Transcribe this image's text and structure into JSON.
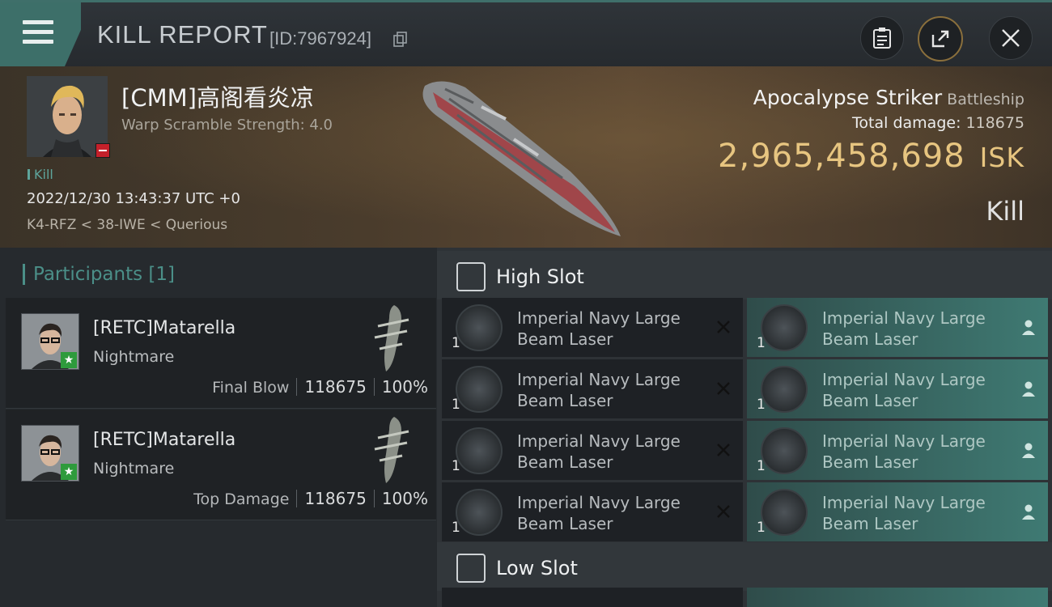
{
  "header": {
    "title": "KILL REPORT",
    "id_label": "[ID:7967924]",
    "icons": [
      "menu-icon",
      "copy-icon",
      "clipboard-icon",
      "share-icon",
      "close-icon"
    ]
  },
  "victim": {
    "name": "[CMM]高阁看炎凉",
    "warp_scramble": "Warp Scramble Strength: 4.0",
    "tag": "Kill",
    "datetime": "2022/12/30 13:43:37 UTC +0",
    "location": "K4-RFZ < 38-IWE < Querious"
  },
  "ship": {
    "name": "Apocalypse Striker",
    "class": "Battleship",
    "total_damage_label": "Total damage:",
    "total_damage_value": "118675",
    "value": "2,965,458,698",
    "currency": "ISK",
    "result": "Kill"
  },
  "participants": {
    "title": "Participants",
    "count": "[1]",
    "rows": [
      {
        "name": "[RETC]Matarella",
        "ship": "Nightmare",
        "role": "Final Blow",
        "damage": "118675",
        "percent": "100%"
      },
      {
        "name": "[RETC]Matarella",
        "ship": "Nightmare",
        "role": "Top Damage",
        "damage": "118675",
        "percent": "100%"
      }
    ]
  },
  "slots": {
    "high": {
      "title": "High Slot",
      "destroyed": [
        {
          "qty": "1",
          "name": "Imperial Navy Large Beam Laser"
        },
        {
          "qty": "1",
          "name": "Imperial Navy Large Beam Laser"
        },
        {
          "qty": "1",
          "name": "Imperial Navy Large Beam Laser"
        },
        {
          "qty": "1",
          "name": "Imperial Navy Large Beam Laser"
        }
      ],
      "dropped": [
        {
          "qty": "1",
          "name": "Imperial Navy Large Beam Laser"
        },
        {
          "qty": "1",
          "name": "Imperial Navy Large Beam Laser"
        },
        {
          "qty": "1",
          "name": "Imperial Navy Large Beam Laser"
        },
        {
          "qty": "1",
          "name": "Imperial Navy Large Beam Laser"
        }
      ]
    },
    "low": {
      "title": "Low Slot"
    }
  },
  "colors": {
    "accent": "#3d6f69",
    "isk": "#e7c580",
    "destroyed": "#1e2125",
    "dropped": "#3f7a73"
  }
}
